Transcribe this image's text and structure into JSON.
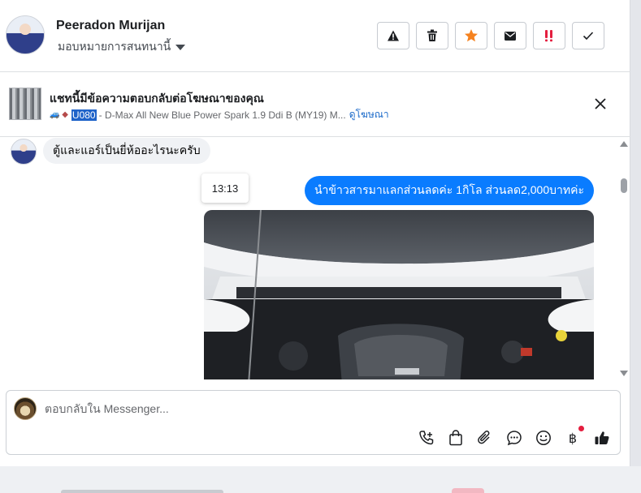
{
  "header": {
    "contact_name": "Peeradon Murijan",
    "assign_label": "มอบหมายการสนทนานี้",
    "actions": [
      {
        "icon": "warning-icon",
        "label": "Report spam"
      },
      {
        "icon": "trash-icon",
        "label": "Delete"
      },
      {
        "icon": "star-icon",
        "label": "Star"
      },
      {
        "icon": "envelope-icon",
        "label": "Mark as unread"
      },
      {
        "icon": "follow-up-icon",
        "label": "Follow up"
      },
      {
        "icon": "check-icon",
        "label": "Mark as done"
      }
    ],
    "star_color": "#f5821f",
    "follow_up_color": "#e41e3f"
  },
  "ad_context": {
    "title": "แชทนี้มีข้อความตอบกลับต่อโฆษณาของคุณ",
    "emoji": "🚙 ◆",
    "ad_code": "U080",
    "ad_text": "- D-Max All New Blue Power Spark 1.9 Ddi B (MY19) M...",
    "view_ad_label": "ดูโฆษณา"
  },
  "messages": {
    "incoming_text": "ตู้และแอร์เป็นยี่ห้ออะไรนะครับ",
    "timestamp": "13:13",
    "outgoing_text": "นำข้าวสารมาแลกส่วนลดค่ะ 1กิโล ส่วนลด2,000บาทค่ะ",
    "outgoing_color": "#0a7cff",
    "photo_description_icon": "engine-photo"
  },
  "composer": {
    "placeholder": "ตอบกลับใน Messenger...",
    "value": "",
    "currency_symbol": "฿",
    "tools": [
      "call-add-icon",
      "shopping-bag-icon",
      "paperclip-icon",
      "saved-reply-icon",
      "emoji-icon",
      "payment-icon",
      "like-icon"
    ]
  }
}
